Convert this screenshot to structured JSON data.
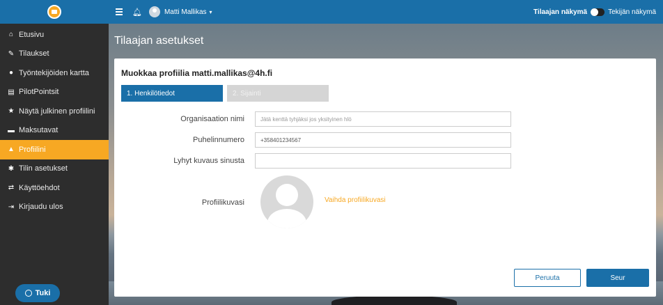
{
  "sidebar": {
    "items": [
      {
        "label": "Etusivu",
        "icon": "home-icon",
        "glyph": "⌂",
        "active": false
      },
      {
        "label": "Tilaukset",
        "icon": "edit-icon",
        "glyph": "✎",
        "active": false
      },
      {
        "label": "Työntekijöiden kartta",
        "icon": "globe-icon",
        "glyph": "●",
        "active": false
      },
      {
        "label": "PilotPointsit",
        "icon": "print-icon",
        "glyph": "▤",
        "active": false
      },
      {
        "label": "Näytä julkinen profiilini",
        "icon": "star-icon",
        "glyph": "★",
        "active": false
      },
      {
        "label": "Maksutavat",
        "icon": "credit-card-icon",
        "glyph": "▬",
        "active": false
      },
      {
        "label": "Profiilini",
        "icon": "user-icon",
        "glyph": "▲",
        "active": true
      },
      {
        "label": "Tilin asetukset",
        "icon": "gear-icon",
        "glyph": "✱",
        "active": false
      },
      {
        "label": "Käyttöehdot",
        "icon": "handshake-icon",
        "glyph": "⇄",
        "active": false
      },
      {
        "label": "Kirjaudu ulos",
        "icon": "logout-icon",
        "glyph": "⇥",
        "active": false
      }
    ],
    "support_label": "Tuki"
  },
  "topbar": {
    "user_name": "Matti Mallikas",
    "caret": "▾",
    "view_customer": "Tilaajan näkymä",
    "view_maker": "Tekijän näkymä"
  },
  "page": {
    "title": "Tilaajan asetukset",
    "card_title": "Muokkaa profiilia matti.mallikas@4h.fi",
    "steps": [
      "1. Henkilötiedot",
      "2. Sijainti"
    ]
  },
  "form": {
    "org_label": "Organisaation nimi",
    "org_value": "",
    "org_placeholder": "Jätä kenttä tyhjäksi jos yksityinen hlö",
    "phone_label": "Puhelinnumero",
    "phone_value": "+358401234567",
    "desc_label": "Lyhyt kuvaus sinusta",
    "desc_value": "",
    "picture_label": "Profiilikuvasi",
    "change_picture": "Vaihda profiilikuvasi"
  },
  "buttons": {
    "cancel": "Peruuta",
    "next": "Seur"
  },
  "colors": {
    "brand_blue": "#1a6fa8",
    "accent_orange": "#f7a823",
    "sidebar_bg": "#2d2d2d"
  }
}
